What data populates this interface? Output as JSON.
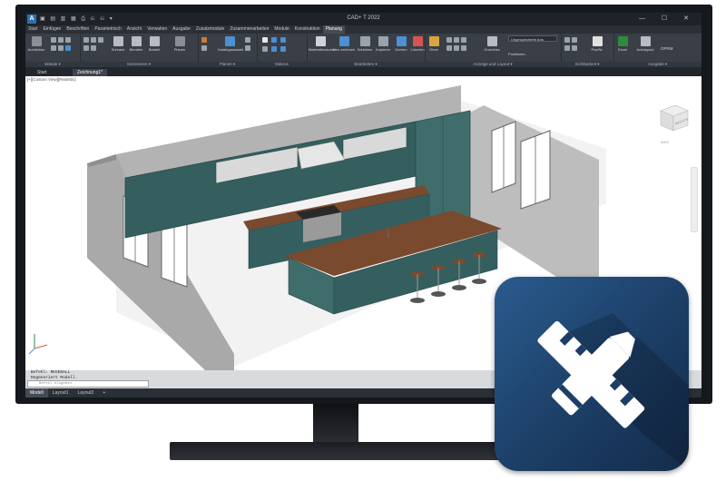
{
  "app": {
    "logo_letter": "A",
    "window_title": "CAD+ T 2022",
    "quick_access": "▣ ▤ ▥ ▦ ⎙ ⎌ ⎌ ▾",
    "window_controls": "— ☐ ✕"
  },
  "menu_tabs": [
    "Start",
    "Einfügen",
    "Beschriften",
    "Parametrisch",
    "Ansicht",
    "Verwalten",
    "Ausgabe",
    "Zusatzmodule",
    "Zusammenarbeiten",
    "Module",
    "Konstruktion",
    "Planung"
  ],
  "active_menu_tab": "Planung",
  "ribbon": {
    "groups": [
      {
        "label": "Wände ▾",
        "tools": [
          "Architektur"
        ]
      },
      {
        "label": "Generieren ▾",
        "tools": [
          "Schrank",
          "Blenden",
          "Bauteil",
          "Planen"
        ]
      },
      {
        "label": "Planen ▾",
        "tools": [
          "Katalogauswahl"
        ]
      },
      {
        "label": "Makros",
        "tools": []
      },
      {
        "label": "Bearbeiten ▾",
        "tools": [
          "Materialtauscher",
          "Neu zeichnen",
          "Schieben",
          "Kopieren",
          "Drehen",
          "Löschen"
        ]
      },
      {
        "label": "Anzeige und Layout ▾",
        "tools": [
          "Ohne",
          "Grundriss",
          "Positionen"
        ]
      },
      {
        "label": "Sichtbarkeit ▾",
        "tools": [
          "Pos/Nr."
        ]
      },
      {
        "label": "Ausgabe ▾",
        "tools": [
          "Excel",
          "Autolayout",
          "OPRM"
        ]
      }
    ],
    "view_dropdown": "Ungespeicherte Ans."
  },
  "doc_tabs": [
    "Start",
    "Zeichnung1*"
  ],
  "active_doc_tab": "Zeichnung1*",
  "viewport": {
    "label": "[+][Custom View][Realistic]",
    "viewcube_label": "RECHTS",
    "wcs_label": "WKS"
  },
  "command": {
    "history": [
      "Befehl: REGENALL",
      "Regeneriert Modell."
    ],
    "placeholder": "Befehl eingeben"
  },
  "layout_tabs": [
    "Modell",
    "Layout1",
    "Layout2",
    "+"
  ],
  "active_layout_tab": "Modell",
  "colors": {
    "cabinet": "#355f5f",
    "cabinet_light": "#3f6d6c",
    "countertop": "#7a4a2e",
    "wall": "#a7a7a7",
    "badge_bg": "#1c3e66"
  },
  "badge_icon": "pencil-ruler-icon"
}
